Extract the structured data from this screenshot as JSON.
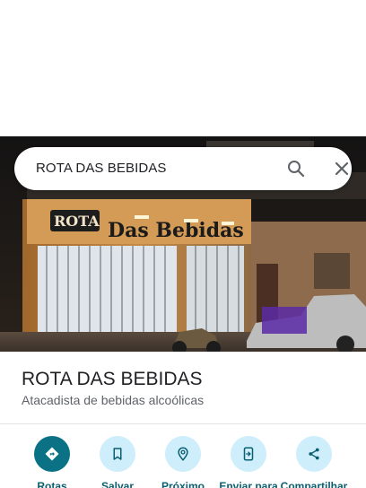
{
  "search": {
    "query": "ROTA DAS BEBIDAS"
  },
  "place": {
    "name": "ROTA DAS BEBIDAS",
    "category": "Atacadista de bebidas alcoólicas",
    "sign_text": "Rota Das Bebidas"
  },
  "actions": [
    {
      "label": "Rotas",
      "icon": "directions-icon"
    },
    {
      "label": "Salvar",
      "icon": "bookmark-icon"
    },
    {
      "label": "Próximo",
      "icon": "nearby-icon"
    },
    {
      "label": "Enviar para",
      "icon": "send-to-phone-icon"
    },
    {
      "label": "Compartilhar",
      "icon": "share-icon"
    }
  ],
  "colors": {
    "accent": "#0b7285",
    "action_bg": "#cfeefb",
    "action_label": "#0b5f70",
    "title": "#202124",
    "subtitle": "#5f6368"
  }
}
